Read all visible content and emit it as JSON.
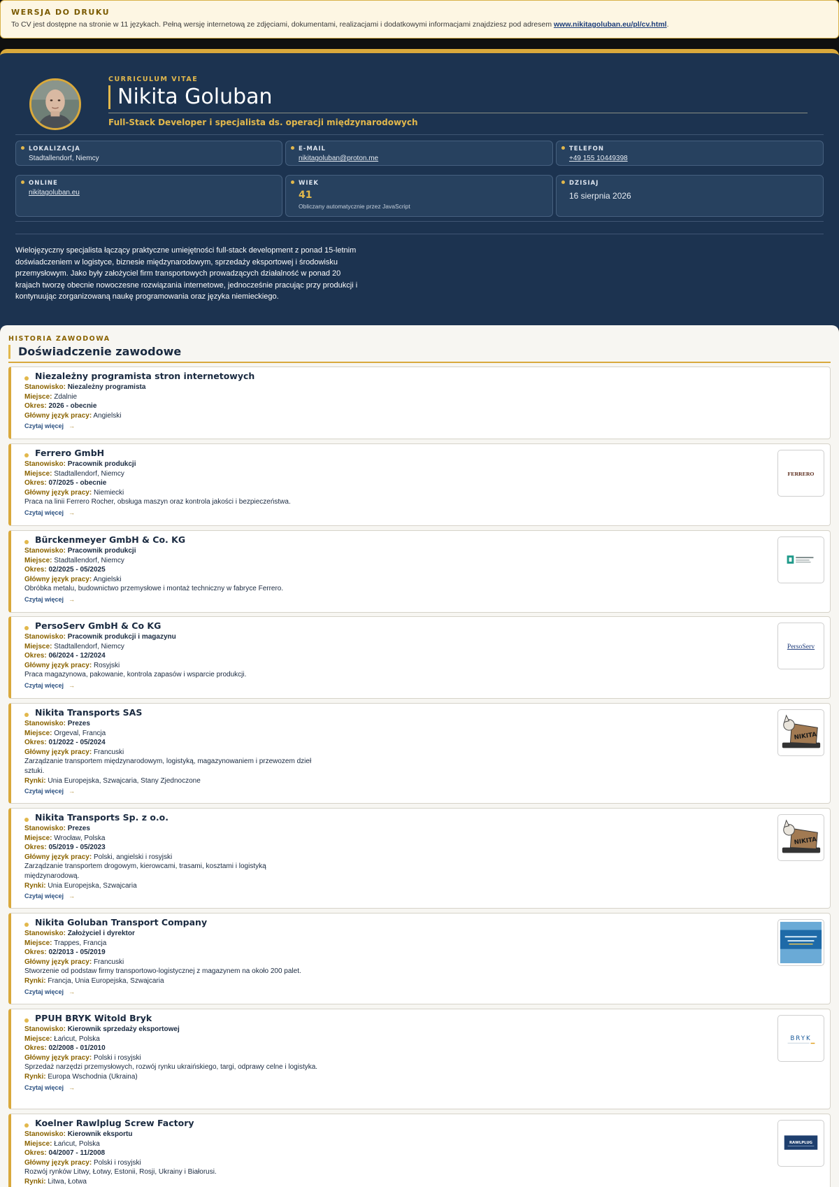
{
  "banner": {
    "title": "WERSJA DO DRUKU",
    "text": "To CV jest dostępne na stronie w 11 językach. Pełną wersję internetową ze zdjęciami, dokumentami, realizacjami i dodatkowymi informacjami znajdziesz pod adresem ",
    "link": "www.nikitagoluban.eu/pl/cv.html",
    "suffix": "."
  },
  "header": {
    "eyebrow": "CURRICULUM VITAE",
    "name": "Nikita Goluban",
    "subtitle": "Full-Stack Developer i specjalista ds. operacji międzynarodowych"
  },
  "info": {
    "location": {
      "label": "LOKALIZACJA",
      "value": "Stadtallendorf, Niemcy"
    },
    "email": {
      "label": "E-MAIL",
      "value": "nikitagoluban@proton.me"
    },
    "phone": {
      "label": "TELEFON",
      "value": "+49 155 10449398"
    },
    "online": {
      "label": "ONLINE",
      "value": "nikitagoluban.eu"
    },
    "age": {
      "label": "WIEK",
      "value": "41",
      "note": "Obliczany automatycznie przez JavaScript"
    },
    "today": {
      "label": "DZISIAJ",
      "value": "16 sierpnia 2026"
    }
  },
  "bio": "Wielojęzyczny specjalista łączący praktyczne umiejętności full-stack development z ponad 15-letnim doświadczeniem w logistyce, biznesie międzynarodowym, sprzedaży eksportowej i środowisku przemysłowym. Jako były założyciel firm transportowych prowadzących działalność w ponad 20 krajach tworzę obecnie nowoczesne rozwiązania internetowe, jednocześnie pracując przy produkcji i kontynuując zorganizowaną naukę programowania oraz języka niemieckiego.",
  "experience": {
    "eyebrow": "HISTORIA ZAWODOWA",
    "title": "Doświadczenie zawodowe",
    "labels": {
      "position": "Stanowisko:",
      "place": "Miejsce:",
      "period": "Okres:",
      "language": "Główny język pracy:",
      "markets": "Rynki:",
      "more": "Czytaj więcej",
      "arrow": "→"
    },
    "jobs": [
      {
        "company": "Niezależny programista stron internetowych",
        "position": "Niezależny programista",
        "place": "Zdalnie",
        "period": "2026 - obecnie",
        "language": "Angielski",
        "description": "",
        "markets": "",
        "logo": "",
        "logo_text": ""
      },
      {
        "company": "Ferrero GmbH",
        "position": "Pracownik produkcji",
        "place": "Stadtallendorf, Niemcy",
        "period": "07/2025 - obecnie",
        "language": "Niemiecki",
        "description": "Praca na linii Ferrero Rocher, obsługa maszyn oraz kontrola jakości i bezpieczeństwa.",
        "markets": "",
        "logo": "ferrero-logo",
        "logo_text": "FERRERO"
      },
      {
        "company": "Bürckenmeyer GmbH & Co. KG",
        "position": "Pracownik produkcji",
        "place": "Stadtallendorf, Niemcy",
        "period": "02/2025 - 05/2025",
        "language": "Angielski",
        "description": "Obróbka metalu, budownictwo przemysłowe i montaż techniczny w fabryce Ferrero.",
        "markets": "",
        "logo": "burckenmeyer-logo",
        "logo_text": ""
      },
      {
        "company": "PersoServ GmbH & Co KG",
        "position": "Pracownik produkcji i magazynu",
        "place": "Stadtallendorf, Niemcy",
        "period": "06/2024 - 12/2024",
        "language": "Rosyjski",
        "description": "Praca magazynowa, pakowanie, kontrola zapasów i wsparcie produkcji.",
        "markets": "",
        "logo": "persoserv-logo",
        "logo_text": "PersoServ"
      },
      {
        "company": "Nikita Transports SAS",
        "position": "Prezes",
        "place": "Orgeval, Francja",
        "period": "01/2022 - 05/2024",
        "language": "Francuski",
        "description": "Zarządzanie transportem międzynarodowym, logistyką, magazynowaniem i przewozem dzieł sztuki.",
        "markets": "Unia Europejska, Szwajcaria, Stany Zjednoczone",
        "logo": "nikita-transports-logo",
        "logo_text": "NIKITA"
      },
      {
        "company": "Nikita Transports Sp. z o.o.",
        "position": "Prezes",
        "place": "Wrocław, Polska",
        "period": "05/2019 - 05/2023",
        "language": "Polski, angielski i rosyjski",
        "description": "Zarządzanie transportem drogowym, kierowcami, trasami, kosztami i logistyką międzynarodową.",
        "markets": "Unia Europejska, Szwajcaria",
        "logo": "nikita-transports-logo",
        "logo_text": "NIKITA"
      },
      {
        "company": "Nikita Goluban Transport Company",
        "position": "Założyciel i dyrektor",
        "place": "Trappes, Francja",
        "period": "02/2013 - 05/2019",
        "language": "Francuski",
        "description": "Stworzenie od podstaw firmy transportowo-logistycznej z magazynem na około 200 palet.",
        "markets": "Francja, Unia Europejska, Szwajcaria",
        "logo": "transport-company-logo",
        "logo_text": ""
      },
      {
        "company": "PPUH BRYK Witold Bryk",
        "position": "Kierownik sprzedaży eksportowej",
        "place": "Łańcut, Polska",
        "period": "02/2008 - 01/2010",
        "language": "Polski i rosyjski",
        "description": "Sprzedaż narzędzi przemysłowych, rozwój rynku ukraińskiego, targi, odprawy celne i logistyka.",
        "markets": "Europa Wschodnia (Ukraina)",
        "logo": "bryk-logo",
        "logo_text": "BRYK"
      },
      {
        "company": "Koelner Rawlplug Screw Factory",
        "position": "Kierownik eksportu",
        "place": "Łańcut, Polska",
        "period": "04/2007 - 11/2008",
        "language": "Polski i rosyjski",
        "description": "Rozwój rynków Litwy, Łotwy, Estonii, Rosji, Ukrainy i Białorusi.",
        "markets": "Litwa, Łotwa",
        "logo": "rawlplug-logo",
        "logo_text": "RAWLPLUG"
      }
    ]
  },
  "colors": {
    "navy": "#1c3350",
    "gold": "#d9a93c",
    "label_gold": "#8a6300",
    "link_blue": "#2d5282"
  }
}
